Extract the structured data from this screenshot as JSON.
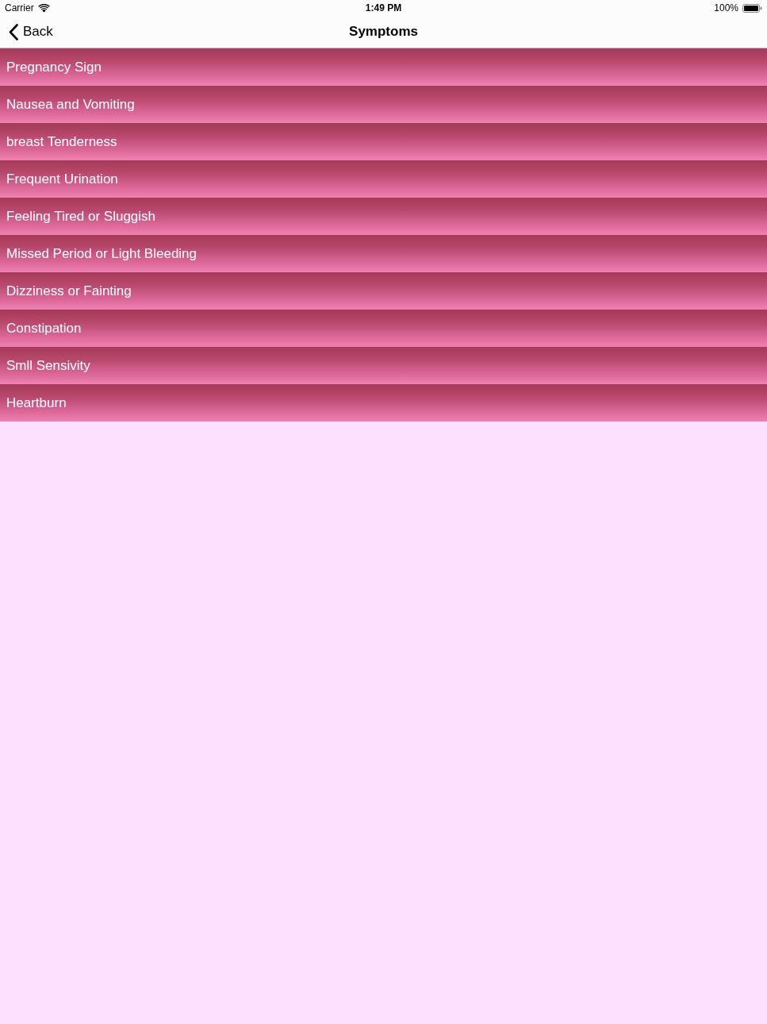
{
  "status_bar": {
    "carrier": "Carrier",
    "time": "1:49 PM",
    "battery": "100%"
  },
  "nav_bar": {
    "back": "Back",
    "title": "Symptoms"
  },
  "list": {
    "items": [
      {
        "label": "Pregnancy Sign"
      },
      {
        "label": "Nausea and Vomiting"
      },
      {
        "label": "breast Tenderness"
      },
      {
        "label": "Frequent Urination"
      },
      {
        "label": "Feeling Tired or Sluggish"
      },
      {
        "label": "Missed Period or Light Bleeding"
      },
      {
        "label": "Dizziness or Fainting"
      },
      {
        "label": "Constipation"
      },
      {
        "label": "Smll Sensivity"
      },
      {
        "label": "Heartburn"
      }
    ]
  }
}
